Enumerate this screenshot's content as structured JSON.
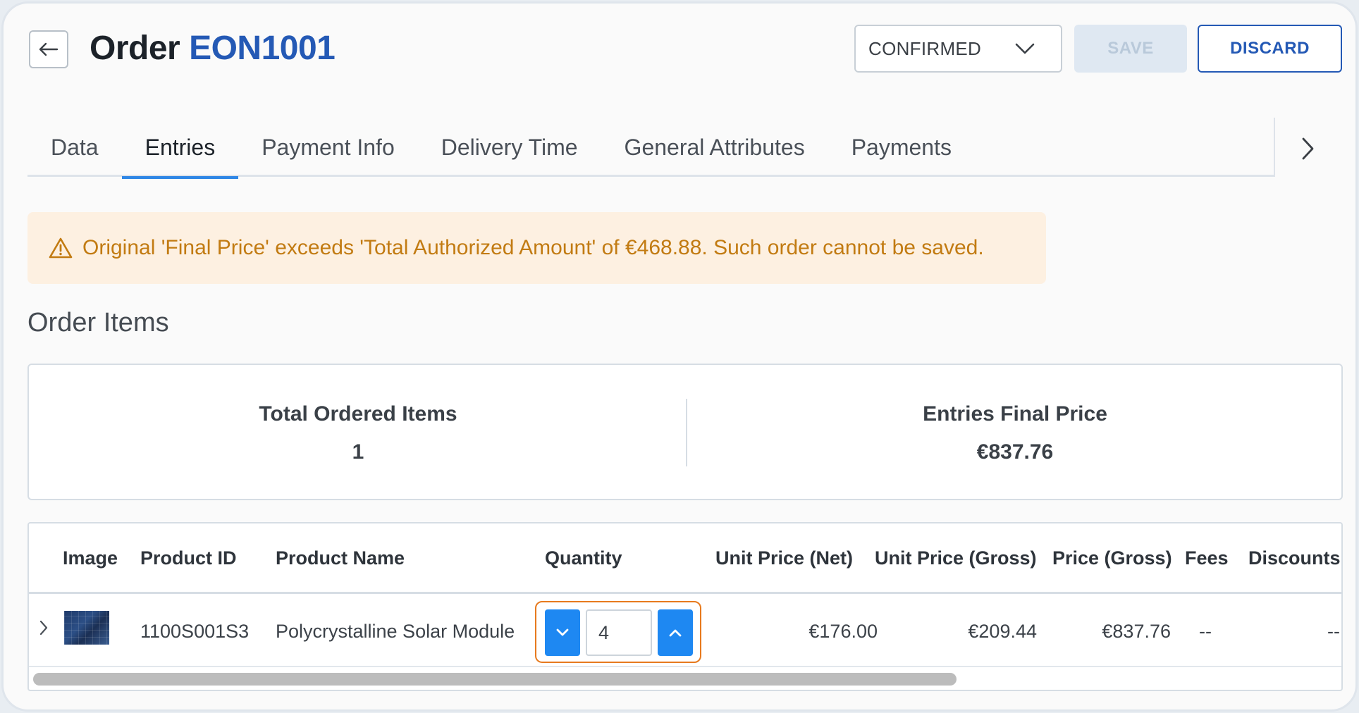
{
  "header": {
    "title_prefix": "Order",
    "order_id": "EON1001",
    "status_value": "CONFIRMED",
    "save_label": "SAVE",
    "discard_label": "DISCARD"
  },
  "tabs": [
    {
      "label": "Data",
      "active": false
    },
    {
      "label": "Entries",
      "active": true
    },
    {
      "label": "Payment Info",
      "active": false
    },
    {
      "label": "Delivery Time",
      "active": false
    },
    {
      "label": "General Attributes",
      "active": false
    },
    {
      "label": "Payments",
      "active": false
    }
  ],
  "alert": {
    "message": "Original 'Final Price' exceeds 'Total Authorized Amount' of €468.88. Such order cannot be saved."
  },
  "section_title": "Order Items",
  "summary": {
    "total_items_label": "Total Ordered Items",
    "total_items_value": "1",
    "final_price_label": "Entries Final Price",
    "final_price_value": "€837.76"
  },
  "table": {
    "columns": [
      "Image",
      "Product ID",
      "Product Name",
      "Quantity",
      "Unit Price (Net)",
      "Unit Price (Gross)",
      "Price (Gross)",
      "Fees",
      "Discounts"
    ],
    "rows": [
      {
        "product_id": "1100S001S3",
        "product_name": "Polycrystalline Solar Module",
        "quantity": "4",
        "unit_price_net": "€176.00",
        "unit_price_gross": "€209.44",
        "price_gross": "€837.76",
        "fees": "--",
        "discounts": "--"
      }
    ]
  },
  "colors": {
    "accent": "#2459b5",
    "tab_indicator": "#2f87e6",
    "stepper": "#1e88f2",
    "alert_text": "#c27b12",
    "alert_bg": "#fdf0e1",
    "focus_outline": "#e77a1e"
  },
  "icons": [
    "arrow-left-icon",
    "chevron-down-icon",
    "chevron-right-icon",
    "warning-icon",
    "chevron-up-icon"
  ]
}
